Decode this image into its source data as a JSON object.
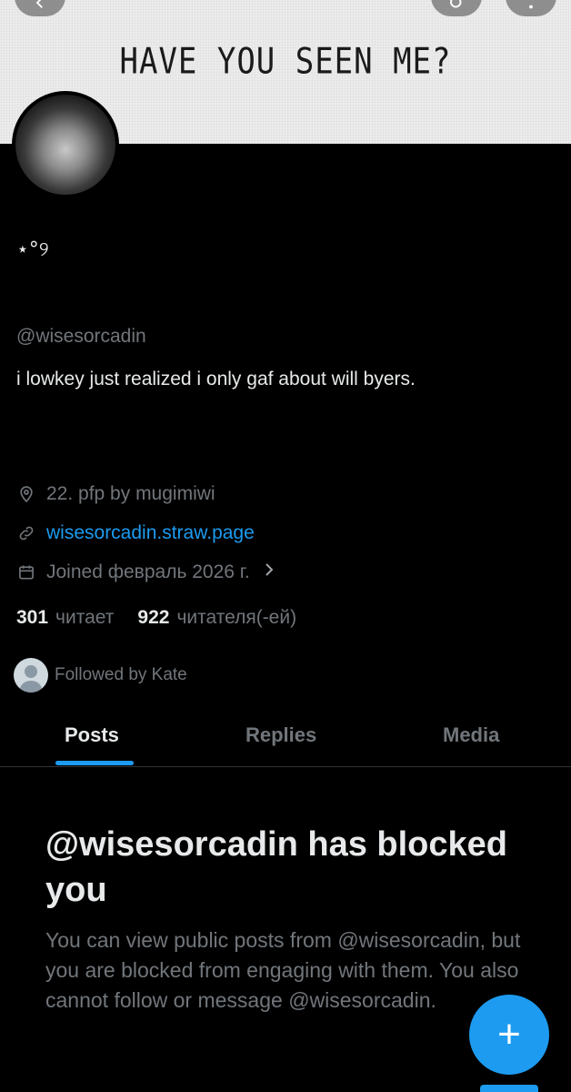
{
  "banner": {
    "text": "HAVE YOU SEEN ME?"
  },
  "header": {
    "back_icon": "chevron-left-icon",
    "search_icon": "search-icon",
    "more_icon": "more-icon"
  },
  "profile": {
    "display_name": "⋆°୨",
    "handle": "@wisesorcadin",
    "bio": "i lowkey just realized i only gaf about will byers.",
    "location": "22. pfp by mugimiwi",
    "website": "wisesorcadin.straw.page",
    "joined": "Joined февраль 2026 г.",
    "following_count": "301",
    "following_label": "читает",
    "followers_count": "922",
    "followers_label": "читателя(-ей)",
    "followed_by": "Followed by Kate"
  },
  "tabs": [
    {
      "label": "Posts",
      "active": true
    },
    {
      "label": "Replies",
      "active": false
    },
    {
      "label": "Media",
      "active": false
    }
  ],
  "blocked": {
    "title": "@wisesorcadin has blocked you",
    "description": "You can view public posts from @wisesorcadin, but you are blocked from engaging with them. You also cannot follow or message @wisesorcadin."
  },
  "fab": {
    "label": "+"
  },
  "colors": {
    "accent": "#1d9bf0",
    "muted": "#71767b",
    "background": "#000000"
  }
}
